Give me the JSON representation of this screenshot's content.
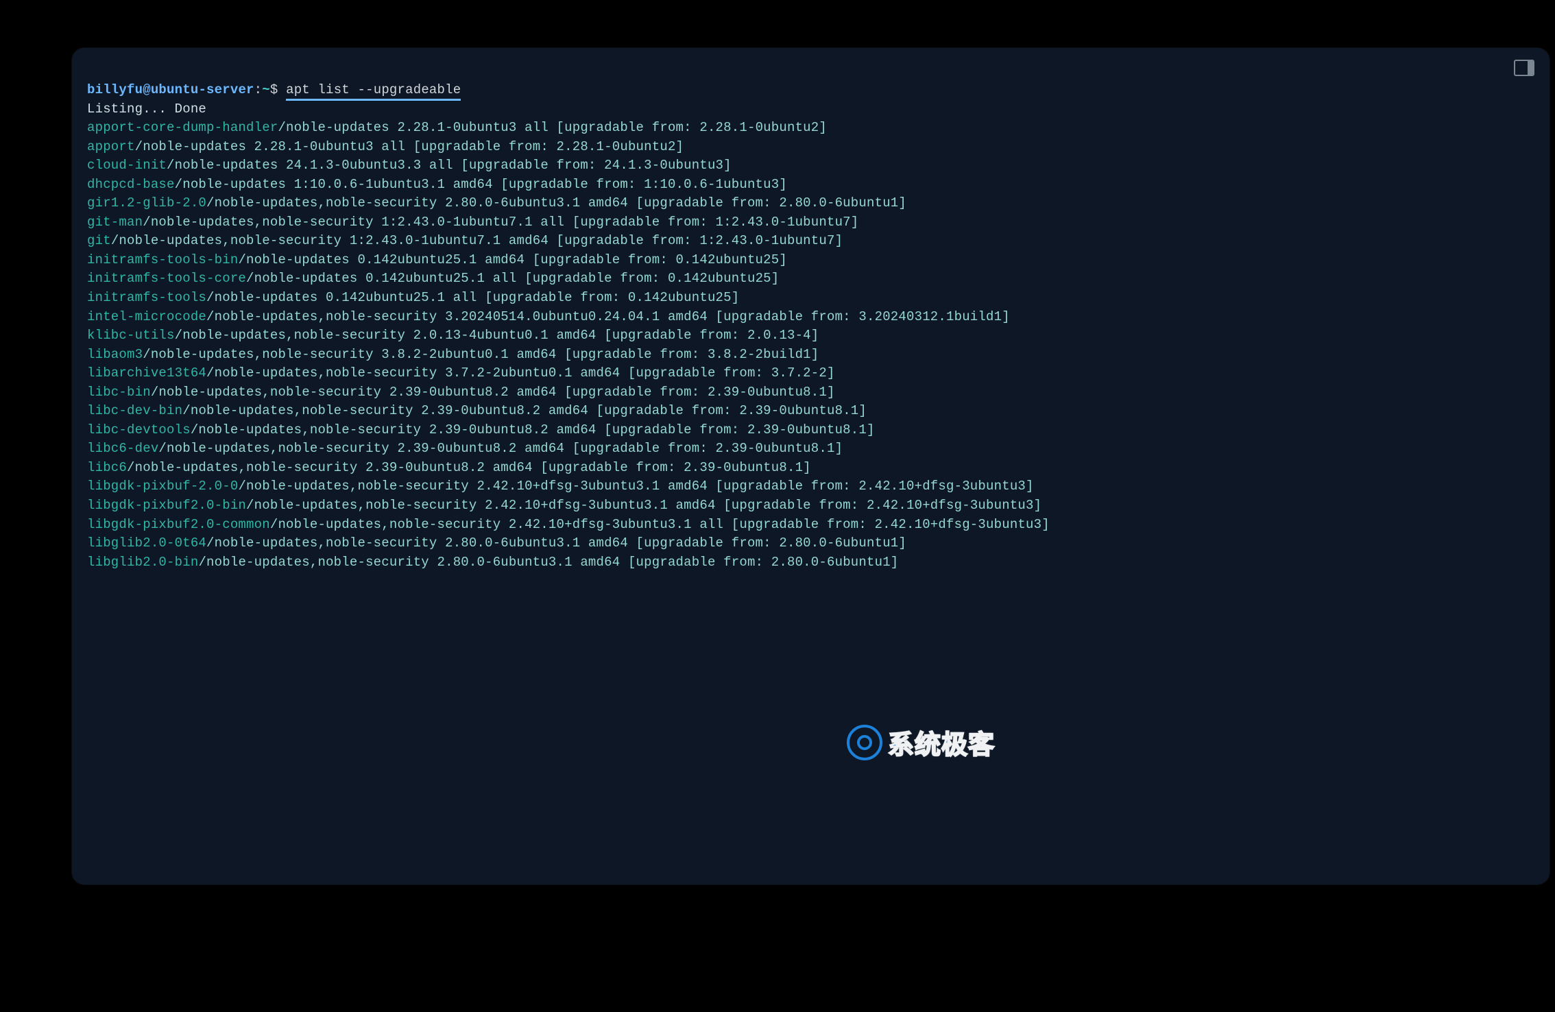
{
  "prompt": {
    "user": "billyfu",
    "at": "@",
    "host": "ubuntu-server",
    "colon": ":",
    "path": "~",
    "dollar": "$ ",
    "command": "apt list --upgradeable"
  },
  "listing_header": "Listing... Done",
  "packages": [
    {
      "name": "apport-core-dump-handler",
      "rest": "/noble-updates 2.28.1-0ubuntu3 all [upgradable from: 2.28.1-0ubuntu2]"
    },
    {
      "name": "apport",
      "rest": "/noble-updates 2.28.1-0ubuntu3 all [upgradable from: 2.28.1-0ubuntu2]"
    },
    {
      "name": "cloud-init",
      "rest": "/noble-updates 24.1.3-0ubuntu3.3 all [upgradable from: 24.1.3-0ubuntu3]"
    },
    {
      "name": "dhcpcd-base",
      "rest": "/noble-updates 1:10.0.6-1ubuntu3.1 amd64 [upgradable from: 1:10.0.6-1ubuntu3]"
    },
    {
      "name": "gir1.2-glib-2.0",
      "rest": "/noble-updates,noble-security 2.80.0-6ubuntu3.1 amd64 [upgradable from: 2.80.0-6ubuntu1]"
    },
    {
      "name": "git-man",
      "rest": "/noble-updates,noble-security 1:2.43.0-1ubuntu7.1 all [upgradable from: 1:2.43.0-1ubuntu7]"
    },
    {
      "name": "git",
      "rest": "/noble-updates,noble-security 1:2.43.0-1ubuntu7.1 amd64 [upgradable from: 1:2.43.0-1ubuntu7]"
    },
    {
      "name": "initramfs-tools-bin",
      "rest": "/noble-updates 0.142ubuntu25.1 amd64 [upgradable from: 0.142ubuntu25]"
    },
    {
      "name": "initramfs-tools-core",
      "rest": "/noble-updates 0.142ubuntu25.1 all [upgradable from: 0.142ubuntu25]"
    },
    {
      "name": "initramfs-tools",
      "rest": "/noble-updates 0.142ubuntu25.1 all [upgradable from: 0.142ubuntu25]"
    },
    {
      "name": "intel-microcode",
      "rest": "/noble-updates,noble-security 3.20240514.0ubuntu0.24.04.1 amd64 [upgradable from: 3.20240312.1build1]"
    },
    {
      "name": "klibc-utils",
      "rest": "/noble-updates,noble-security 2.0.13-4ubuntu0.1 amd64 [upgradable from: 2.0.13-4]"
    },
    {
      "name": "libaom3",
      "rest": "/noble-updates,noble-security 3.8.2-2ubuntu0.1 amd64 [upgradable from: 3.8.2-2build1]"
    },
    {
      "name": "libarchive13t64",
      "rest": "/noble-updates,noble-security 3.7.2-2ubuntu0.1 amd64 [upgradable from: 3.7.2-2]"
    },
    {
      "name": "libc-bin",
      "rest": "/noble-updates,noble-security 2.39-0ubuntu8.2 amd64 [upgradable from: 2.39-0ubuntu8.1]"
    },
    {
      "name": "libc-dev-bin",
      "rest": "/noble-updates,noble-security 2.39-0ubuntu8.2 amd64 [upgradable from: 2.39-0ubuntu8.1]"
    },
    {
      "name": "libc-devtools",
      "rest": "/noble-updates,noble-security 2.39-0ubuntu8.2 amd64 [upgradable from: 2.39-0ubuntu8.1]"
    },
    {
      "name": "libc6-dev",
      "rest": "/noble-updates,noble-security 2.39-0ubuntu8.2 amd64 [upgradable from: 2.39-0ubuntu8.1]"
    },
    {
      "name": "libc6",
      "rest": "/noble-updates,noble-security 2.39-0ubuntu8.2 amd64 [upgradable from: 2.39-0ubuntu8.1]"
    },
    {
      "name": "libgdk-pixbuf-2.0-0",
      "rest": "/noble-updates,noble-security 2.42.10+dfsg-3ubuntu3.1 amd64 [upgradable from: 2.42.10+dfsg-3ubuntu3]"
    },
    {
      "name": "libgdk-pixbuf2.0-bin",
      "rest": "/noble-updates,noble-security 2.42.10+dfsg-3ubuntu3.1 amd64 [upgradable from: 2.42.10+dfsg-3ubuntu3]"
    },
    {
      "name": "libgdk-pixbuf2.0-common",
      "rest": "/noble-updates,noble-security 2.42.10+dfsg-3ubuntu3.1 all [upgradable from: 2.42.10+dfsg-3ubuntu3]"
    },
    {
      "name": "libglib2.0-0t64",
      "rest": "/noble-updates,noble-security 2.80.0-6ubuntu3.1 amd64 [upgradable from: 2.80.0-6ubuntu1]"
    },
    {
      "name": "libglib2.0-bin",
      "rest": "/noble-updates,noble-security 2.80.0-6ubuntu3.1 amd64 [upgradable from: 2.80.0-6ubuntu1]"
    }
  ],
  "watermark": {
    "text": "系统极客"
  }
}
